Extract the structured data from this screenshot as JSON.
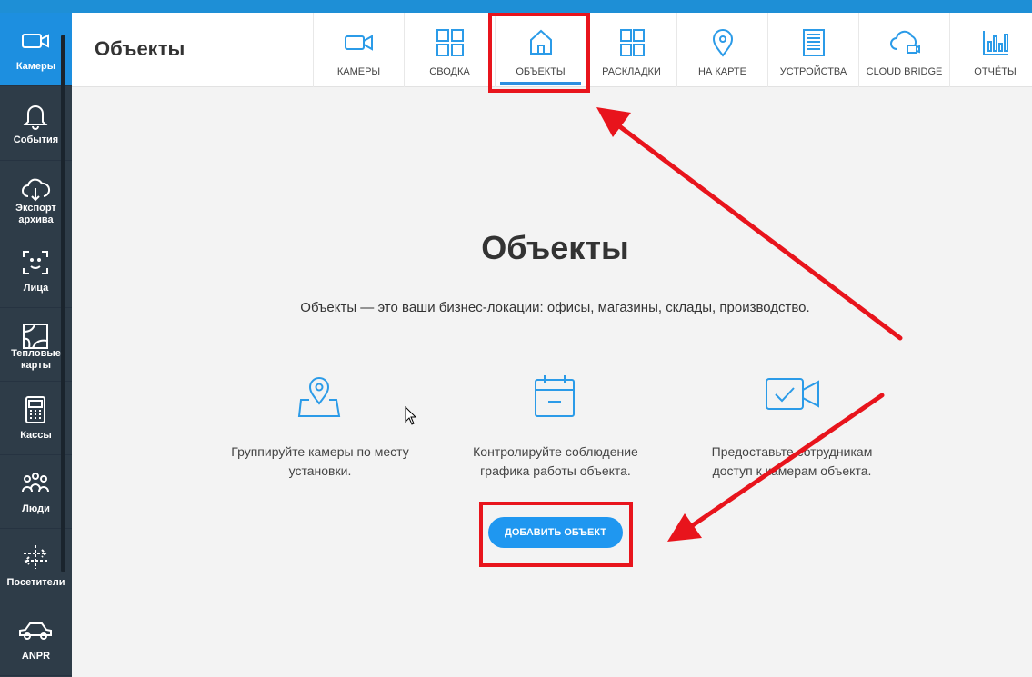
{
  "sidebar": {
    "items": [
      {
        "label": "Камеры",
        "icon": "video-camera-icon",
        "active": true
      },
      {
        "label": "События",
        "icon": "bell-icon"
      },
      {
        "label": "Экспорт архива",
        "icon": "cloud-download-icon"
      },
      {
        "label": "Лица",
        "icon": "face-scan-icon"
      },
      {
        "label": "Тепловые карты",
        "icon": "heatmap-icon"
      },
      {
        "label": "Кассы",
        "icon": "cash-register-icon"
      },
      {
        "label": "Люди",
        "icon": "people-icon"
      },
      {
        "label": "Посетители",
        "icon": "visitors-arrows-icon"
      },
      {
        "label": "ANPR",
        "icon": "car-icon"
      }
    ]
  },
  "header": {
    "title": "Объекты",
    "tabs": [
      {
        "label": "КАМЕРЫ",
        "icon": "video-camera-icon"
      },
      {
        "label": "СВОДКА",
        "icon": "grid-icon"
      },
      {
        "label": "ОБЪЕКТЫ",
        "icon": "home-icon",
        "active": true
      },
      {
        "label": "РАСКЛАДКИ",
        "icon": "layout-icon"
      },
      {
        "label": "НА КАРТЕ",
        "icon": "map-pin-icon"
      },
      {
        "label": "УСТРОЙСТВА",
        "icon": "server-icon"
      },
      {
        "label": "CLOUD BRIDGE",
        "icon": "cloud-bridge-icon"
      },
      {
        "label": "ОТЧЁТЫ",
        "icon": "bar-chart-icon"
      }
    ]
  },
  "main": {
    "title": "Объекты",
    "subtitle": "Объекты — это ваши бизнес-локации: офисы, магазины, склады, производство.",
    "features": [
      {
        "icon": "map-location-icon",
        "line1": "Группируйте камеры по месту",
        "line2": "установки."
      },
      {
        "icon": "calendar-icon",
        "line1": "Контролируйте соблюдение",
        "line2": "графика работы объекта."
      },
      {
        "icon": "video-check-icon",
        "line1": "Предоставьте сотрудникам",
        "line2": "доступ к камерам объекта."
      }
    ],
    "add_button": "ДОБАВИТЬ ОБЪЕКТ"
  },
  "colors": {
    "accent": "#1f97f0",
    "sidebar_bg": "#2e3c48",
    "annotation_red": "#e8141c",
    "icon_blue": "#2b9be8"
  }
}
